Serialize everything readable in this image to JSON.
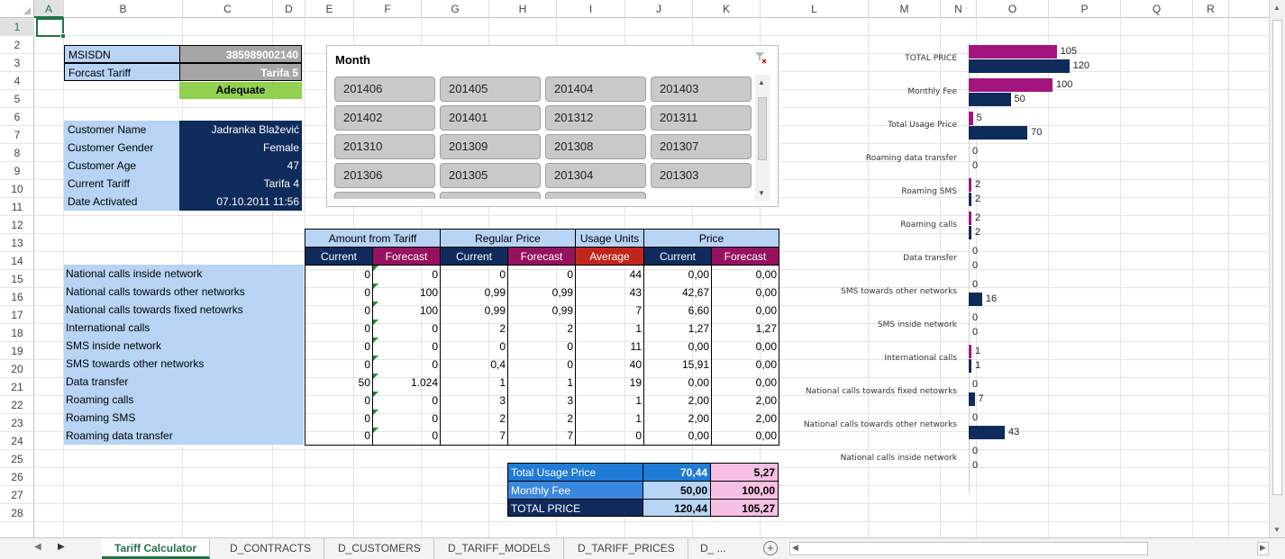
{
  "columns": [
    "A",
    "B",
    "C",
    "D",
    "E",
    "F",
    "G",
    "H",
    "I",
    "J",
    "K",
    "L",
    "M",
    "N",
    "O",
    "P",
    "Q",
    "R"
  ],
  "rows": [
    "1",
    "2",
    "3",
    "4",
    "5",
    "6",
    "7",
    "8",
    "9",
    "10",
    "11",
    "12",
    "13",
    "14",
    "15",
    "16",
    "17",
    "18",
    "19",
    "20",
    "21",
    "22",
    "23",
    "24",
    "25",
    "26",
    "27",
    "28"
  ],
  "selected_cell": "A1",
  "info": {
    "msisdn_label": "MSISDN",
    "msisdn_value": "385989002140",
    "forecast_label": "Forcast Tariff",
    "forecast_value": "Tarifa 5",
    "status": "Adequate",
    "customer_name_label": "Customer Name",
    "customer_name_value": "Jadranka Blažević",
    "customer_gender_label": "Customer Gender",
    "customer_gender_value": "Female",
    "customer_age_label": "Customer Age",
    "customer_age_value": "47",
    "current_tariff_label": "Current Tariff",
    "current_tariff_value": "Tarifa 4",
    "date_activated_label": "Date Activated",
    "date_activated_value": "07.10.2011 11:56"
  },
  "slicer": {
    "title": "Month",
    "items": [
      "201406",
      "201405",
      "201404",
      "201403",
      "201402",
      "201401",
      "201312",
      "201311",
      "201310",
      "201309",
      "201308",
      "201307",
      "201306",
      "201305",
      "201304",
      "201303"
    ]
  },
  "table": {
    "group_headers": [
      "Amount from Tariff",
      "Regular Price",
      "Usage Units",
      "Price"
    ],
    "sub_headers": [
      "Current",
      "Forecast",
      "Current",
      "Forecast",
      "Average",
      "Current",
      "Forecast"
    ],
    "rows": [
      {
        "label": "National calls inside network",
        "cells": [
          "0",
          "0",
          "0",
          "0",
          "44",
          "0,00",
          "0,00"
        ]
      },
      {
        "label": "National calls towards other networks",
        "cells": [
          "0",
          "100",
          "0,99",
          "0,99",
          "43",
          "42,67",
          "0,00"
        ]
      },
      {
        "label": "National calls towards fixed netowrks",
        "cells": [
          "0",
          "100",
          "0,99",
          "0,99",
          "7",
          "6,60",
          "0,00"
        ]
      },
      {
        "label": "International calls",
        "cells": [
          "0",
          "0",
          "2",
          "2",
          "1",
          "1,27",
          "1,27"
        ]
      },
      {
        "label": "SMS inside network",
        "cells": [
          "0",
          "0",
          "0",
          "0",
          "11",
          "0,00",
          "0,00"
        ]
      },
      {
        "label": "SMS towards other networks",
        "cells": [
          "0",
          "0",
          "0,4",
          "0",
          "40",
          "15,91",
          "0,00"
        ]
      },
      {
        "label": "Data transfer",
        "cells": [
          "50",
          "1.024",
          "1",
          "1",
          "19",
          "0,00",
          "0,00"
        ]
      },
      {
        "label": "Roaming calls",
        "cells": [
          "0",
          "0",
          "3",
          "3",
          "1",
          "2,00",
          "2,00"
        ]
      },
      {
        "label": "Roaming SMS",
        "cells": [
          "0",
          "0",
          "2",
          "2",
          "1",
          "2,00",
          "2,00"
        ]
      },
      {
        "label": "Roaming data transfer",
        "cells": [
          "0",
          "0",
          "7",
          "7",
          "0",
          "0,00",
          "0,00"
        ]
      }
    ],
    "totals": [
      {
        "label": "Total Usage Price",
        "current": "70,44",
        "forecast": "5,27"
      },
      {
        "label": "Monthly Fee",
        "current": "50,00",
        "forecast": "100,00"
      },
      {
        "label": "TOTAL PRICE",
        "current": "120,44",
        "forecast": "105,27"
      }
    ]
  },
  "chart_data": {
    "type": "bar",
    "orientation": "horizontal",
    "categories": [
      "TOTAL PRICE",
      "Monthly Fee",
      "Total Usage Price",
      "Roaming data transfer",
      "Roaming SMS",
      "Roaming calls",
      "Data transfer",
      "SMS towards other networks",
      "SMS inside network",
      "International calls",
      "National calls towards fixed netowrks",
      "National calls towards other networks",
      "National calls inside network"
    ],
    "series": [
      {
        "name": "",
        "color": "#a3157e",
        "values": [
          105,
          100,
          5,
          0,
          2,
          2,
          0,
          0,
          0,
          1,
          0,
          0,
          0
        ]
      },
      {
        "name": "",
        "color": "#0e2b5c",
        "values": [
          120,
          50,
          70,
          0,
          2,
          2,
          0,
          16,
          0,
          1,
          7,
          43,
          0
        ]
      }
    ],
    "xlim": [
      0,
      130
    ],
    "legend": "none",
    "grid": false
  },
  "colors": {
    "navy": "#0e2b5c",
    "magenta": "#a3157e",
    "light_blue": "#b7d4f5",
    "green_ok": "#92d050",
    "excel_green": "#217346"
  },
  "sheet_tabs": [
    "Tariff Calculator",
    "D_CONTRACTS",
    "D_CUSTOMERS",
    "D_TARIFF_MODELS",
    "D_TARIFF_PRICES",
    "D_ ..."
  ],
  "active_tab": "Tariff Calculator"
}
